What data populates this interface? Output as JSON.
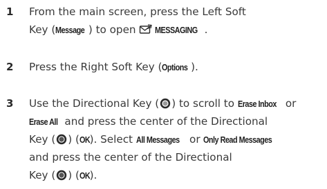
{
  "steps": [
    {
      "number": "1",
      "lines": {
        "l1": "From the main screen, press the Left Soft",
        "l2a": "Key (",
        "l2b": "Message",
        "l2c": ") to open ",
        "l2d": "MESSAGING",
        "l2e": "."
      }
    },
    {
      "number": "2",
      "lines": {
        "l1a": "Press the Right Soft Key (",
        "l1b": "Options",
        "l1c": ")."
      }
    },
    {
      "number": "3",
      "lines": {
        "l1a": "Use the Directional Key (",
        "l1b": ") to scroll to ",
        "l1c": "Erase Inbox",
        "l1d": " or",
        "l2a": "Erase All",
        "l2b": " and press the center of the Directional",
        "l3a": "Key (",
        "l3b": ") (",
        "l3c": "OK",
        "l3d": "). Select ",
        "l3e": "All Messages",
        "l3f": " or ",
        "l3g": "Only Read Messages",
        "l4": "and press the center of the Directional",
        "l5a": "Key (",
        "l5b": ") (",
        "l5c": "OK",
        "l5d": ")."
      }
    }
  ],
  "icons": {
    "directional_key": "directional-key-icon",
    "directional_key_center": "directional-key-center-icon",
    "messaging": "messaging-envelope-icon"
  }
}
